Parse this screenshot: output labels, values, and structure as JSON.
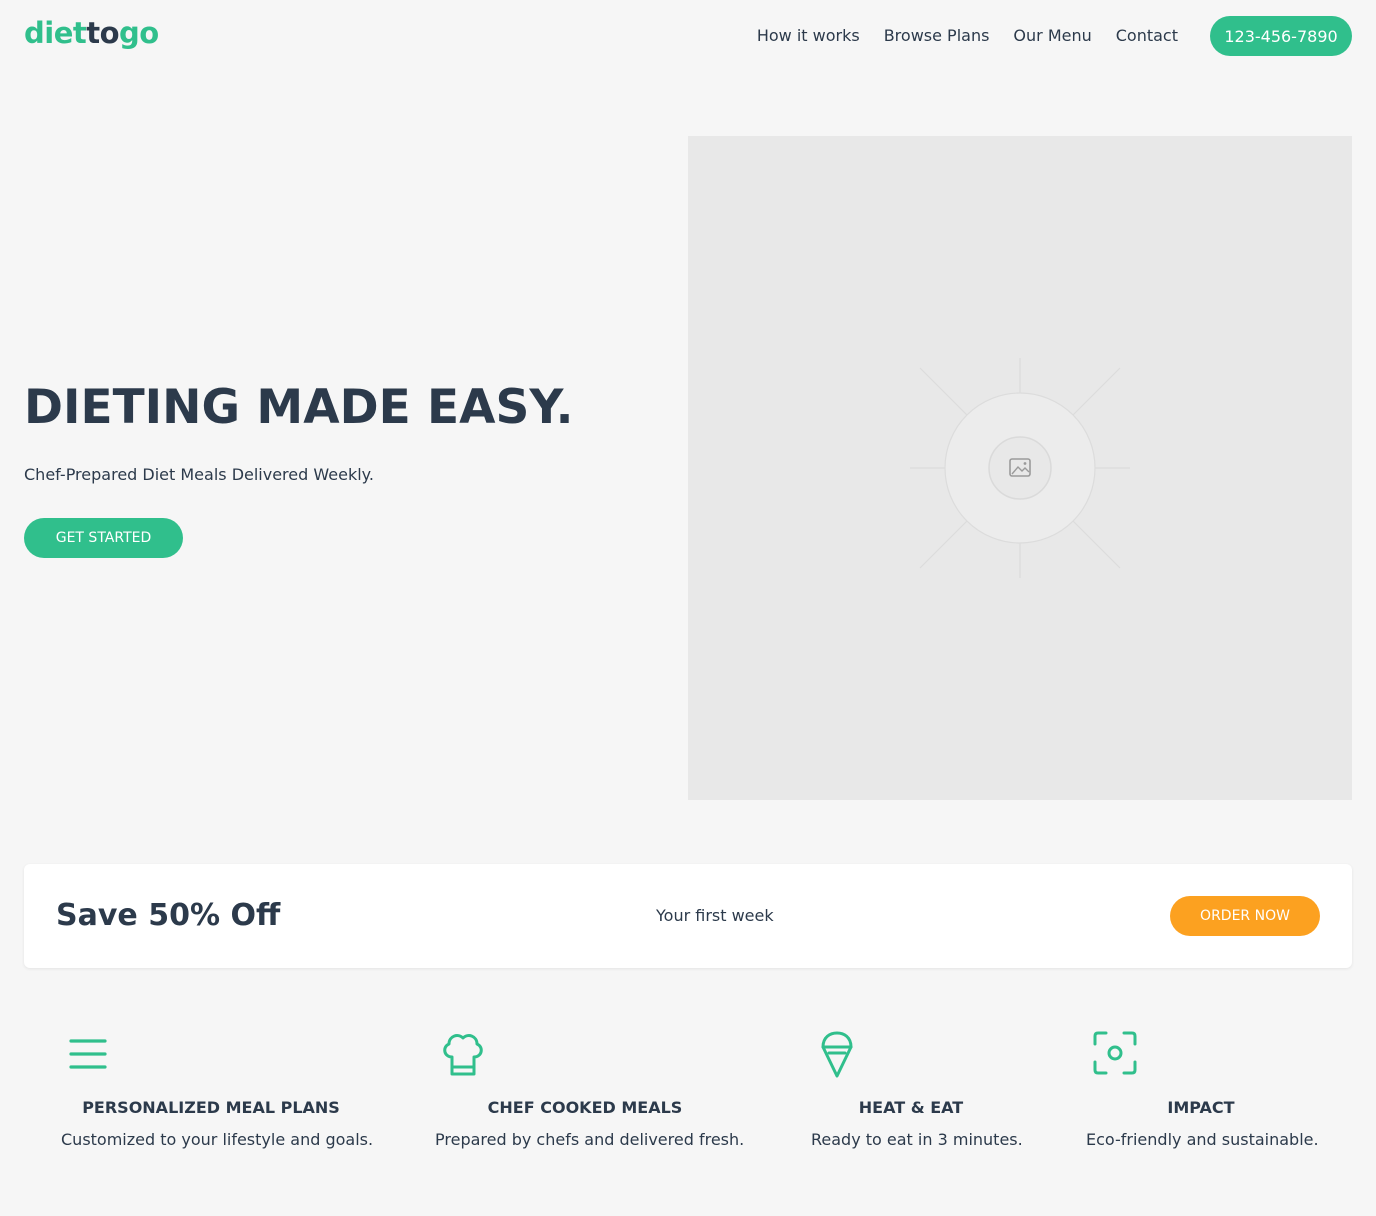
{
  "header": {
    "logo_part1": "diet",
    "logo_part2": "to",
    "logo_part3": "go",
    "nav": [
      "How it works",
      "Browse Plans",
      "Our Menu",
      "Contact"
    ],
    "phone": "123-456-7890"
  },
  "hero": {
    "title": "DIETING MADE EASY.",
    "subtitle": "Chef-Prepared Diet Meals Delivered Weekly.",
    "cta": "GET STARTED",
    "image_icon": "image-placeholder-icon"
  },
  "promo": {
    "title": "Save 50% Off",
    "subtitle": "Your first week",
    "cta": "ORDER NOW"
  },
  "features": [
    {
      "icon": "menu-lines-icon",
      "title": "PERSONALIZED MEAL PLANS",
      "description": "Customized to your lifestyle and goals."
    },
    {
      "icon": "chef-hat-icon",
      "title": "CHEF COOKED MEALS",
      "description": "Prepared by chefs and delivered fresh."
    },
    {
      "icon": "ice-cream-cone-icon",
      "title": "HEAT & EAT",
      "description": "Ready to eat in 3 minutes."
    },
    {
      "icon": "focus-frame-icon",
      "title": "IMPACT",
      "description": "Eco-friendly and sustainable."
    }
  ],
  "colors": {
    "brand_green": "#30bf8c",
    "accent_orange": "#fca120",
    "text_dark": "#2c3a4b",
    "background": "#f6f6f6"
  }
}
